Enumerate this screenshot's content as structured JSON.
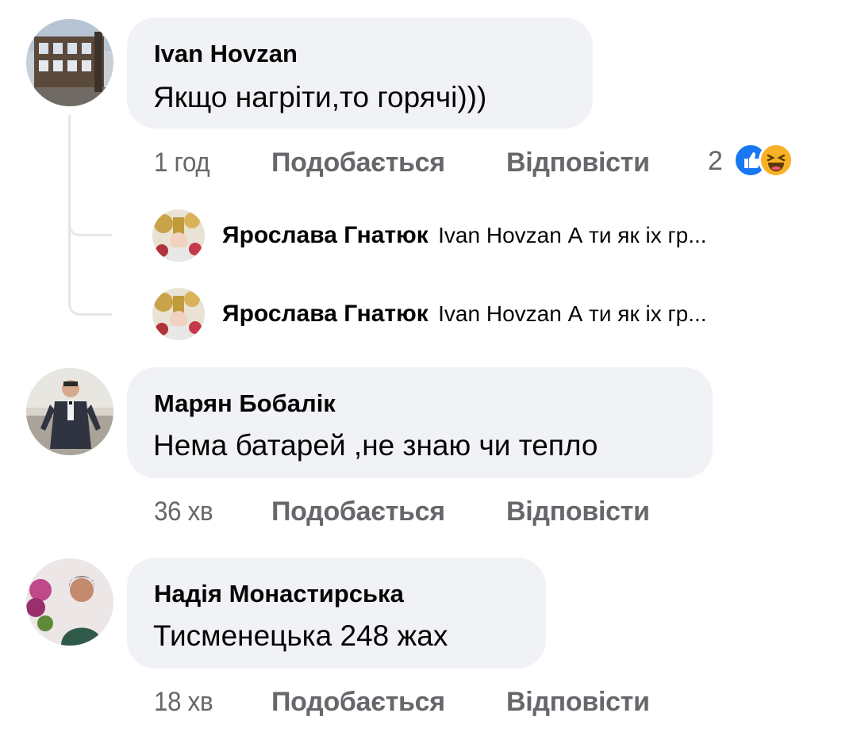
{
  "comments": [
    {
      "author": "Ivan Hovzan",
      "text": "Якщо нагріти,то горячі)))",
      "time": "1 год",
      "like_label": "Подобається",
      "reply_label": "Відповісти",
      "reaction_count": "2",
      "reaction_icons": [
        "like-icon",
        "haha-icon"
      ],
      "replies": [
        {
          "author": "Ярослава Гнатюк",
          "preview": "Ivan Hovzan А ти як іх гр..."
        },
        {
          "author": "Ярослава Гнатюк",
          "preview": "Ivan Hovzan А ти як іх гр..."
        }
      ]
    },
    {
      "author": "Марян Бобалік",
      "text": "Нема батарей ,не знаю чи тепло",
      "time": "36 хв",
      "like_label": "Подобається",
      "reply_label": "Відповісти"
    },
    {
      "author": "Надія Монастирська",
      "text": "Тисменецька 248 жах",
      "time": "18 хв",
      "like_label": "Подобається",
      "reply_label": "Відповісти"
    }
  ],
  "colors": {
    "bubble": "#f0f2f5",
    "meta_text": "#65676b",
    "like_blue": "#1877f2",
    "haha_yellow": "#f7b125"
  }
}
